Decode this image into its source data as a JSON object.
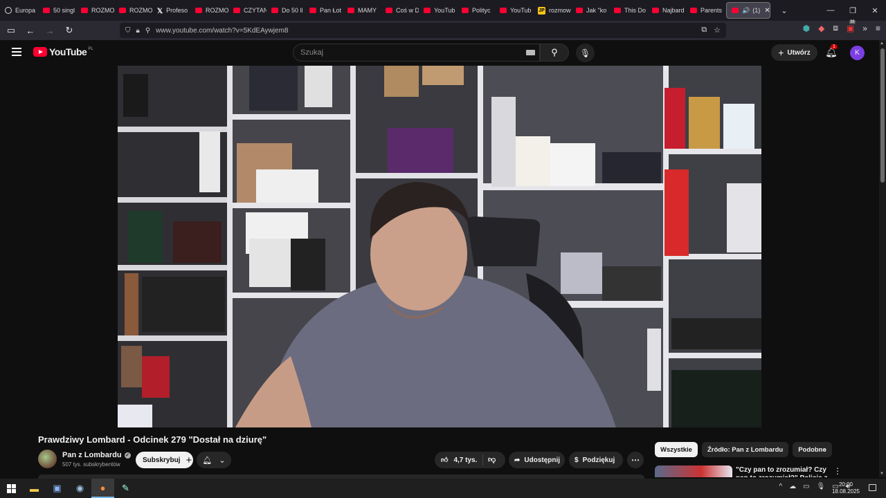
{
  "browser": {
    "tabs": [
      {
        "label": "Europa",
        "icon": "globe-icon"
      },
      {
        "label": "50 singl",
        "icon": "youtube-icon"
      },
      {
        "label": "ROZMO",
        "icon": "youtube-icon"
      },
      {
        "label": "ROZMO",
        "icon": "youtube-icon"
      },
      {
        "label": "Profeso",
        "icon": "x-icon"
      },
      {
        "label": "ROZMO",
        "icon": "youtube-icon"
      },
      {
        "label": "CZYTAN",
        "icon": "youtube-icon"
      },
      {
        "label": "Do 50 ll",
        "icon": "youtube-icon"
      },
      {
        "label": "Pan Łot",
        "icon": "youtube-icon"
      },
      {
        "label": "MAMY",
        "icon": "youtube-icon"
      },
      {
        "label": "Coś w D",
        "icon": "youtube-icon"
      },
      {
        "label": "YouTub",
        "icon": "youtube-icon"
      },
      {
        "label": "Polityc",
        "icon": "youtube-icon"
      },
      {
        "label": "YouTub",
        "icon": "youtube-icon"
      },
      {
        "label": "rozmow",
        "icon": "jp-icon"
      },
      {
        "label": "Jak \"ko",
        "icon": "youtube-icon"
      },
      {
        "label": "This Do",
        "icon": "youtube-icon"
      },
      {
        "label": "Najbard",
        "icon": "youtube-icon"
      },
      {
        "label": "Parents",
        "icon": "youtube-icon"
      }
    ],
    "active_tab": {
      "label": "(1)",
      "audio": "🔊",
      "close": "✕"
    },
    "url": "www.youtube.com/watch?v=5KdEAywjem8",
    "extension_badge": "38"
  },
  "youtube": {
    "logo_text": "YouTube",
    "country": "PL",
    "search_placeholder": "Szukaj",
    "create_label": "Utwórz",
    "notifications_count": "1",
    "avatar_letter": "K"
  },
  "video": {
    "title": "Prawdziwy Lombard - Odcinek 279 \"Dostał na dziurę\"",
    "channel": "Pan z Lombardu",
    "subscribers": "507 tys. subskrybentów",
    "subscribe_label": "Subskrybuj",
    "likes": "4,7 tys.",
    "share_label": "Udostępnij",
    "thanks_label": "Podziękuj"
  },
  "sidebar": {
    "chips": [
      "Wszystkie",
      "Źródło: Pan z Lombardu",
      "Podobne"
    ],
    "recommendation_title": "\"Czy pan to zrozumiał? Czy pan to zrozumiał?\" Policja z okrop"
  },
  "taskbar": {
    "time": "20:00",
    "date": "18.08.2025"
  }
}
